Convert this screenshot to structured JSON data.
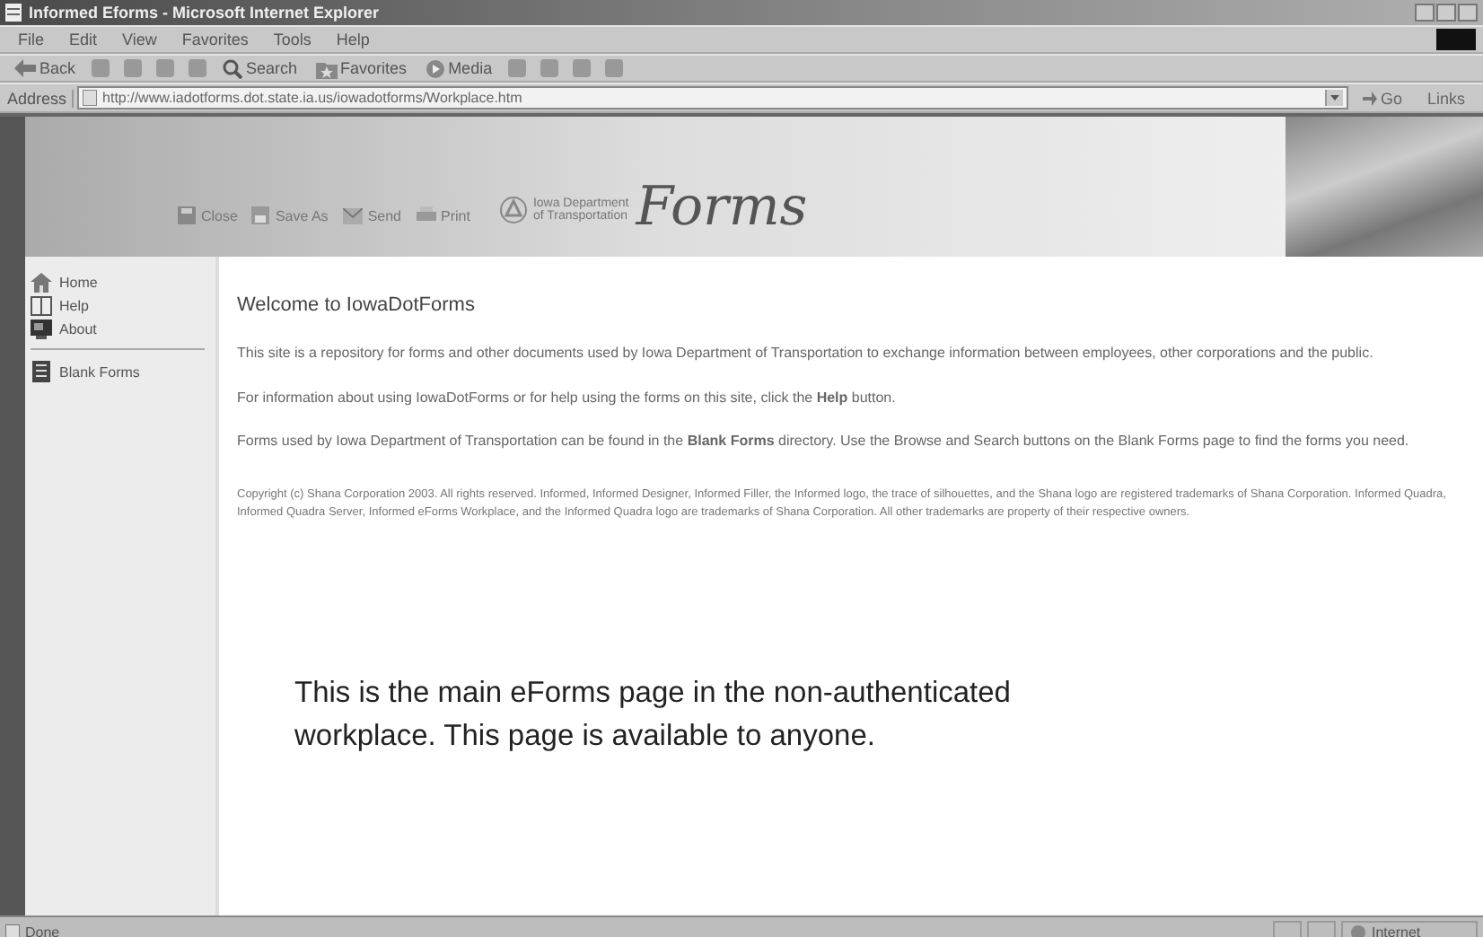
{
  "window": {
    "title": "Informed Eforms - Microsoft Internet Explorer"
  },
  "menu": [
    "File",
    "Edit",
    "View",
    "Favorites",
    "Tools",
    "Help"
  ],
  "toolbar": [
    {
      "label": "Back",
      "kind": "back"
    },
    {
      "label": "Search",
      "kind": "search"
    },
    {
      "label": "Favorites",
      "kind": "favorites"
    },
    {
      "label": "Media",
      "kind": "media"
    }
  ],
  "address": {
    "label": "Address",
    "value": "http://www.iadotforms.dot.state.ia.us/iowadotforms/Workplace.htm",
    "go": "Go",
    "links": "Links"
  },
  "banner": {
    "tools": [
      {
        "label": "Close",
        "kind": "close"
      },
      {
        "label": "Save As",
        "kind": "save"
      },
      {
        "label": "Send",
        "kind": "send"
      },
      {
        "label": "Print",
        "kind": "print"
      }
    ],
    "agency": [
      "Iowa Department",
      "of Transportation"
    ],
    "logo": "Forms"
  },
  "sidebar": {
    "items": [
      {
        "label": "Home",
        "kind": "home"
      },
      {
        "label": "Help",
        "kind": "help"
      },
      {
        "label": "About",
        "kind": "about"
      },
      {
        "label": "Blank Forms",
        "kind": "forms"
      }
    ]
  },
  "content": {
    "heading": "Welcome to IowaDotForms",
    "paragraphs": [
      "This site is a repository for forms and other documents used by Iowa Department of Transportation to exchange information between employees, other corporations and the public.",
      "For information about using IowaDotForms or for help using the forms on this site, click the **Help** button.",
      "Forms used by Iowa Department of Transportation can be found in the **Blank Forms** directory. Use the Browse and Search buttons on the Blank Forms page to find the forms you need."
    ],
    "copyright": "Copyright (c) Shana Corporation 2003. All rights reserved. Informed, Informed Designer, Informed Filler, the Informed logo, the trace of silhouettes, and the Shana logo are registered trademarks of Shana Corporation. Informed Quadra, Informed Quadra Server, Informed eForms Workplace, and the Informed Quadra logo are trademarks of Shana Corporation. All other trademarks are property of their respective owners."
  },
  "caption": "This is the main eForms page in the non-authenticated workplace. This page is available to anyone.",
  "status_bar": {
    "text": "Done",
    "zone": "Internet"
  }
}
